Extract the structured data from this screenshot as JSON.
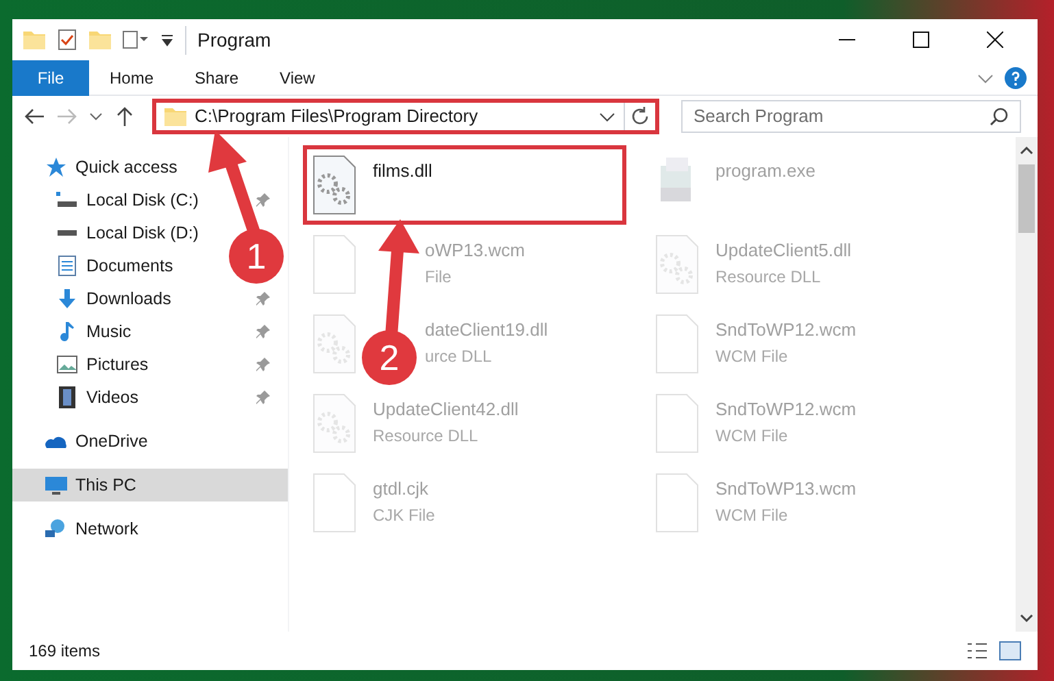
{
  "window": {
    "title": "Program"
  },
  "ribbon": {
    "file_button": "File",
    "tabs": [
      "Home",
      "Share",
      "View"
    ]
  },
  "address": {
    "path": "C:\\Program Files\\Program Directory",
    "outlined": true
  },
  "search": {
    "placeholder": "Search Program"
  },
  "sidebar": {
    "items": [
      {
        "label": "Quick access",
        "selected": false,
        "children": [
          {
            "label": "Local Disk (C:)",
            "pinned": true
          },
          {
            "label": "Local Disk (D:)",
            "pinned": false
          },
          {
            "label": "Documents",
            "pinned": false
          },
          {
            "label": "Downloads",
            "pinned": true
          },
          {
            "label": "Music",
            "pinned": true
          },
          {
            "label": "Pictures",
            "pinned": true
          },
          {
            "label": "Videos",
            "pinned": true
          }
        ]
      },
      {
        "label": "OneDrive",
        "selected": false
      },
      {
        "label": "This PC",
        "selected": true
      },
      {
        "label": "Network",
        "selected": false
      }
    ]
  },
  "files": [
    {
      "name": "films.dll",
      "kind": "dll",
      "faded": false,
      "outlined": true
    },
    {
      "name": "program.exe",
      "kind": "exe",
      "faded": true
    },
    {
      "name": "oWP13.wcm",
      "type": "File",
      "kind": "file",
      "faded": true,
      "partly_covered": true
    },
    {
      "name": "UpdateClient5.dll",
      "type": "Resource DLL",
      "kind": "dll",
      "faded": true
    },
    {
      "name": "dateClient19.dll",
      "type": "urce DLL",
      "kind": "dll",
      "faded": true,
      "partly_covered": true
    },
    {
      "name": "SndToWP12.wcm",
      "type": "WCM File",
      "kind": "file",
      "faded": true
    },
    {
      "name": "UpdateClient42.dll",
      "type": "Resource DLL",
      "kind": "dll",
      "faded": true
    },
    {
      "name": "SndToWP12.wcm",
      "type": "WCM File",
      "kind": "file",
      "faded": true
    },
    {
      "name": "gtdl.cjk",
      "type": "CJK File",
      "kind": "file",
      "faded": true
    },
    {
      "name": "SndToWP13.wcm",
      "type": "WCM File",
      "kind": "file",
      "faded": true
    }
  ],
  "status_bar": {
    "count": "169 items"
  },
  "annotations": [
    {
      "number": "1"
    },
    {
      "number": "2"
    }
  ]
}
